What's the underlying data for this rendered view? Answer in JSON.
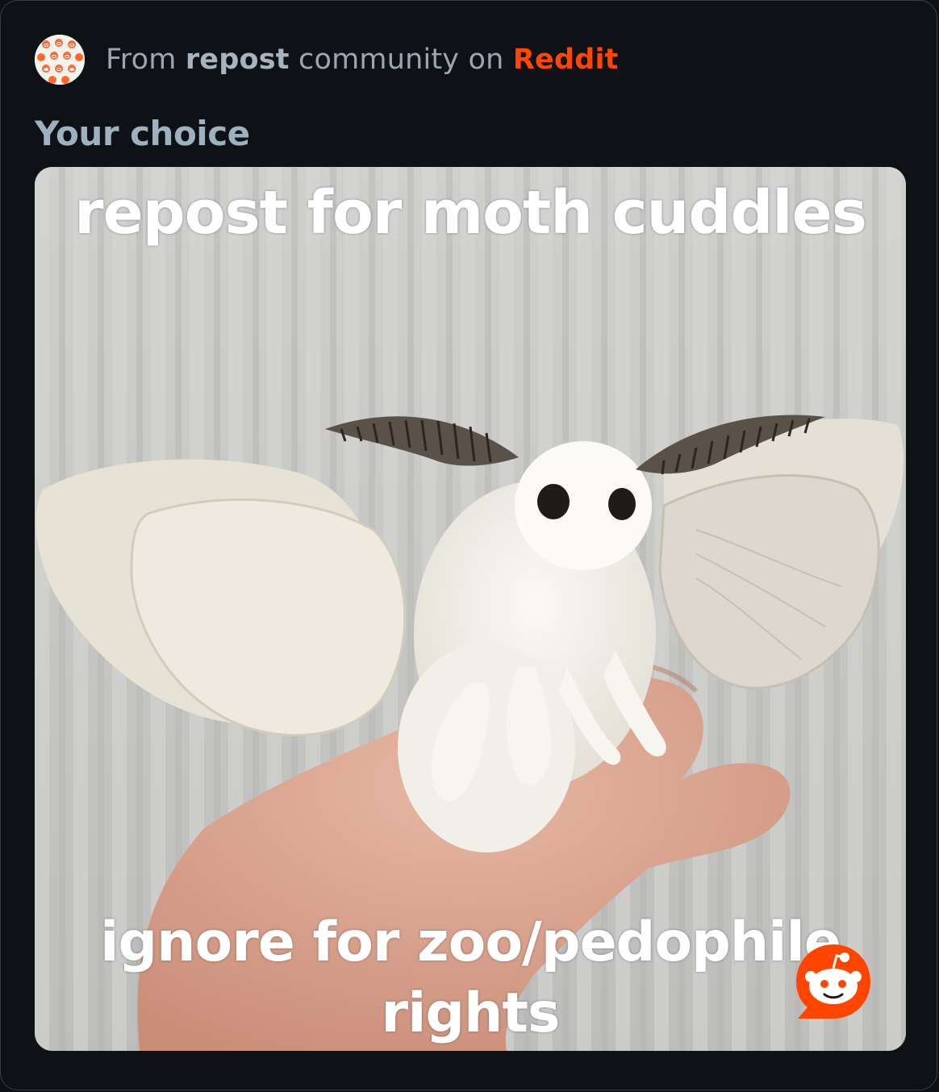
{
  "header": {
    "prefix": "From ",
    "community": "repost",
    "middle": " community on ",
    "platform": "Reddit",
    "avatar_icon": "community-avatar-icon"
  },
  "post": {
    "title": "Your choice"
  },
  "meme": {
    "top_text": "repost  for moth cuddles",
    "bottom_text": "ignore for zoo/pedophile rights"
  },
  "colors": {
    "background": "#0e1217",
    "accent": "#ff4500",
    "title": "#9db1bf",
    "muted_text": "#9aa7b2"
  },
  "badge_icon": "reddit-snoo-icon"
}
